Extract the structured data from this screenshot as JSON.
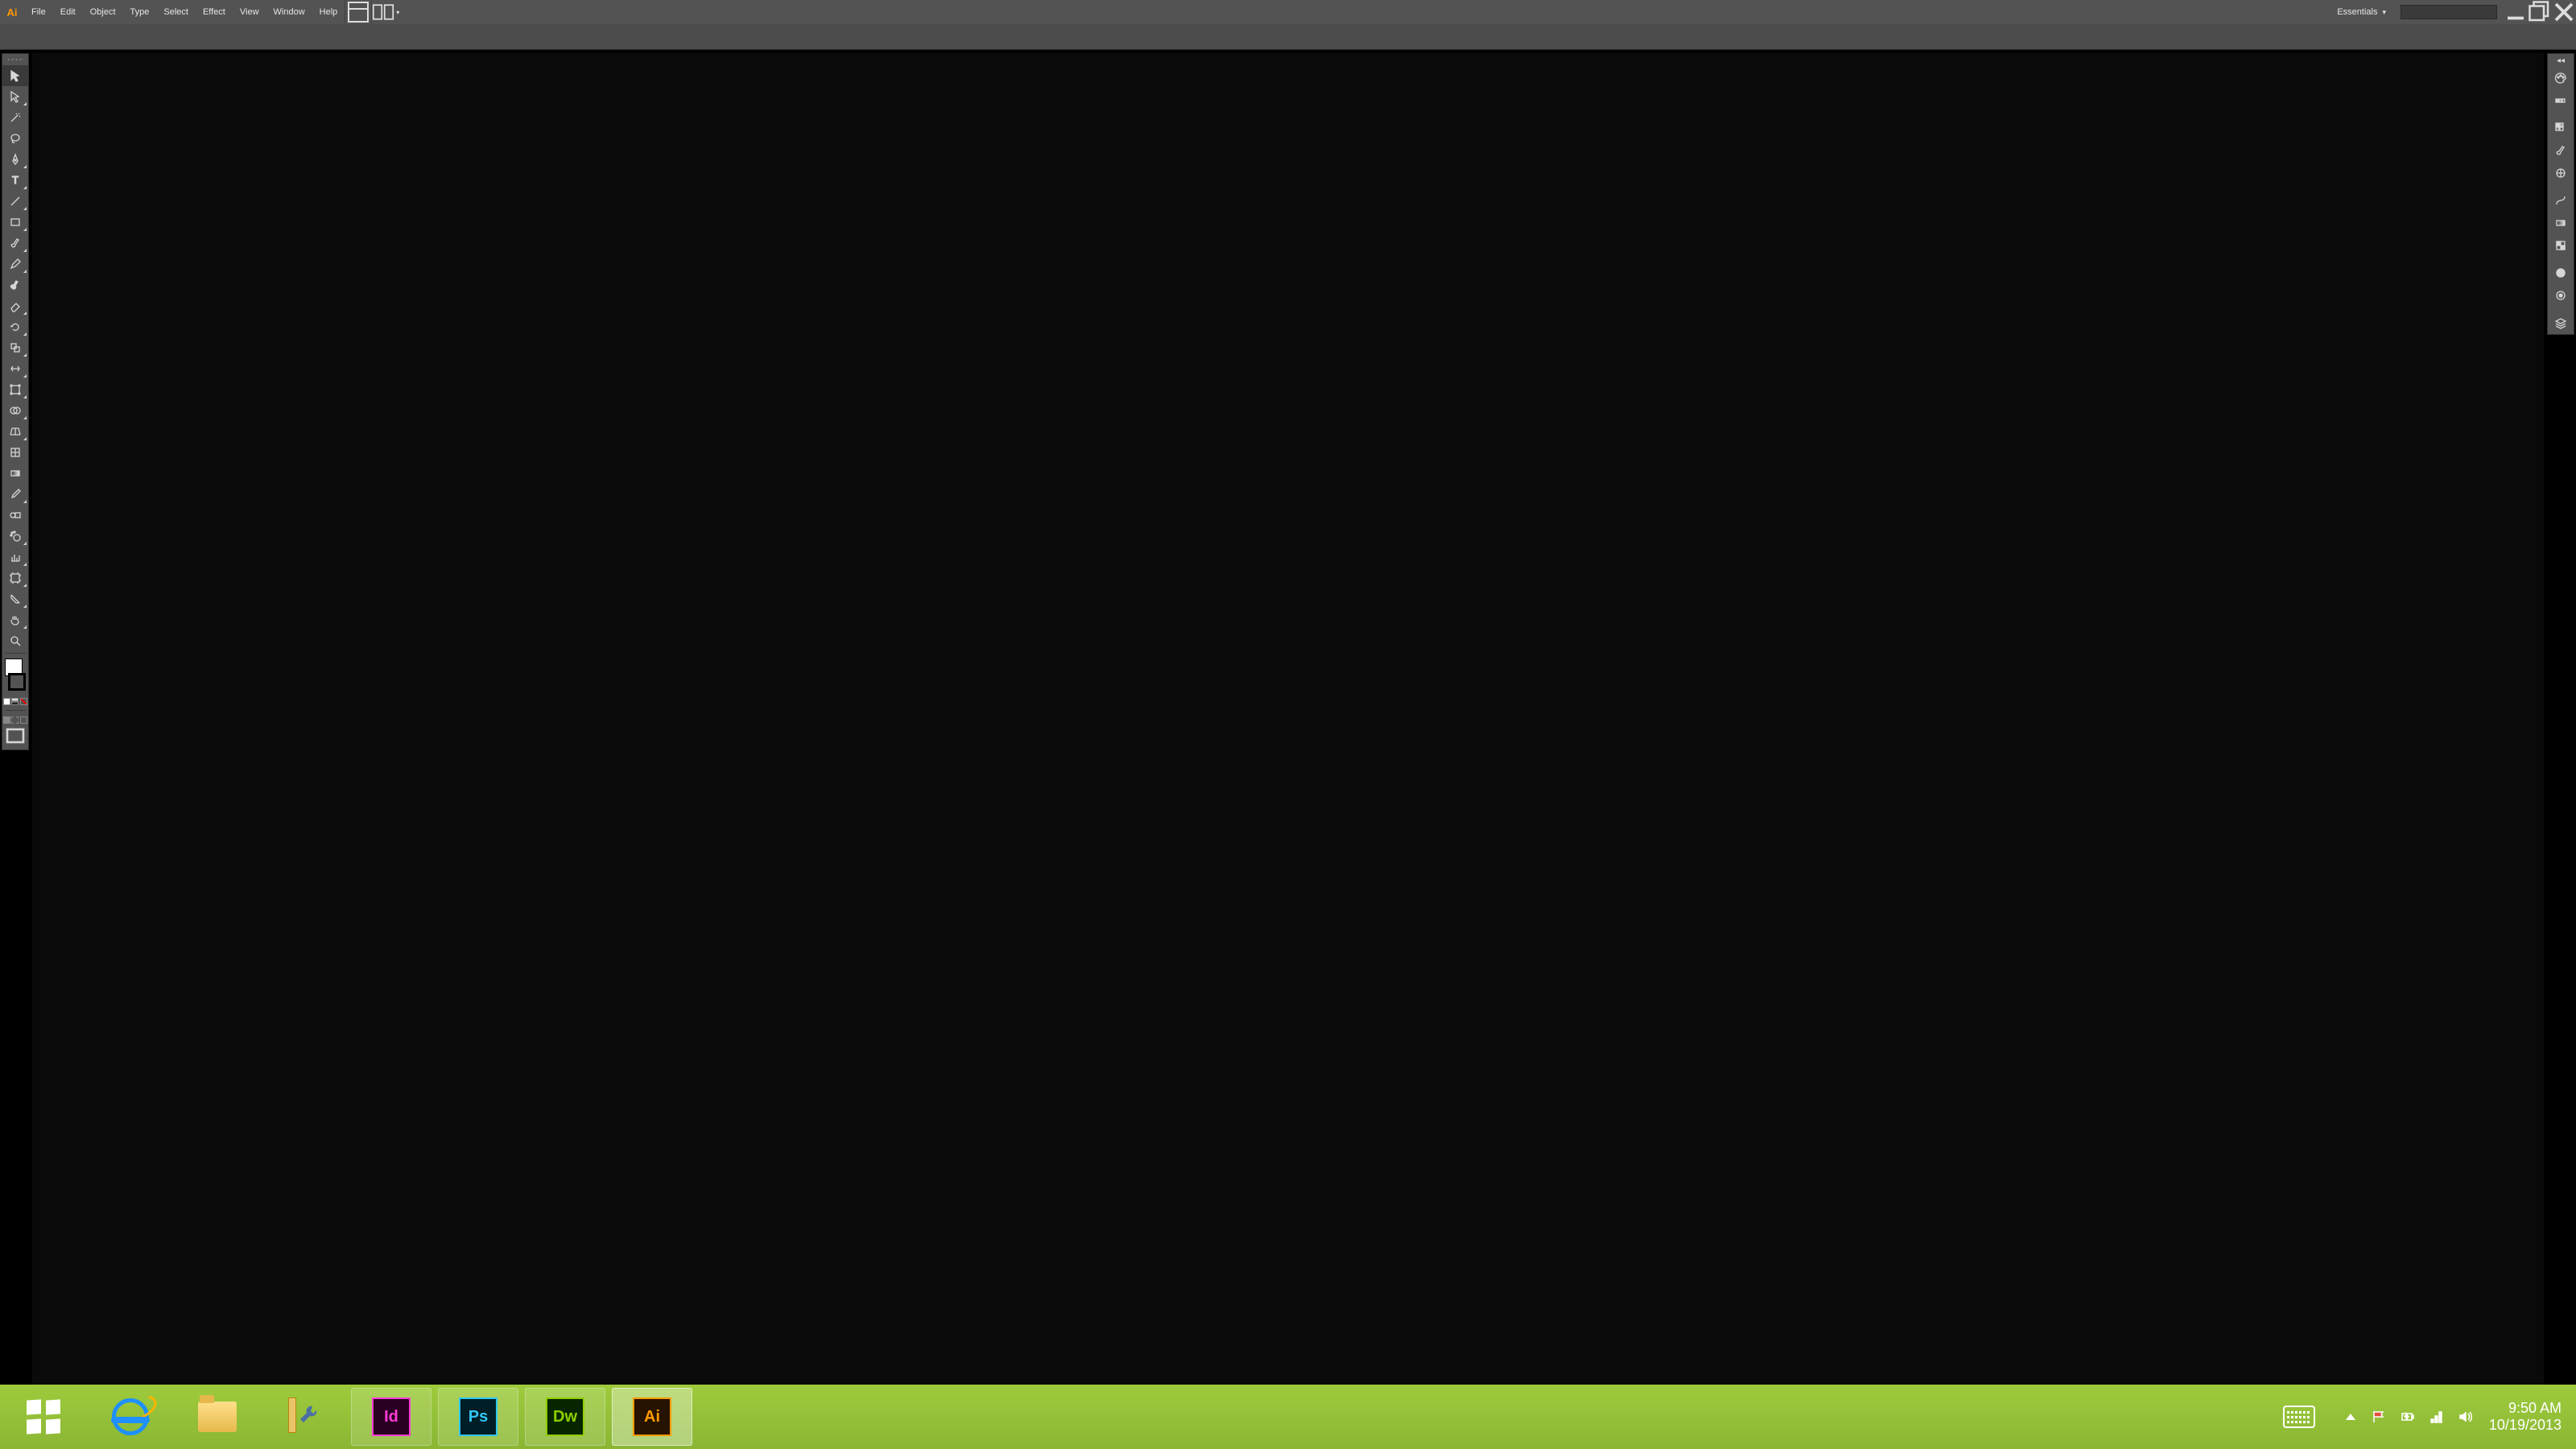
{
  "app": {
    "logo_text": "Ai"
  },
  "menu": {
    "items": [
      "File",
      "Edit",
      "Object",
      "Type",
      "Select",
      "Effect",
      "View",
      "Window",
      "Help"
    ]
  },
  "workspace": {
    "label": "Essentials"
  },
  "tools": [
    {
      "name": "selection-tool",
      "glyph": "arrow",
      "selected": true,
      "flyout": false
    },
    {
      "name": "direct-selection-tool",
      "glyph": "hollow-arrow",
      "flyout": true
    },
    {
      "name": "magic-wand-tool",
      "glyph": "wand",
      "flyout": false
    },
    {
      "name": "lasso-tool",
      "glyph": "lasso",
      "flyout": false
    },
    {
      "name": "pen-tool",
      "glyph": "pen",
      "flyout": true
    },
    {
      "name": "type-tool",
      "glyph": "T",
      "flyout": true
    },
    {
      "name": "line-segment-tool",
      "glyph": "line",
      "flyout": true
    },
    {
      "name": "rectangle-tool",
      "glyph": "rect",
      "flyout": true
    },
    {
      "name": "paintbrush-tool",
      "glyph": "brush",
      "flyout": true
    },
    {
      "name": "pencil-tool",
      "glyph": "pencil",
      "flyout": true
    },
    {
      "name": "blob-brush-tool",
      "glyph": "blob",
      "flyout": false
    },
    {
      "name": "eraser-tool",
      "glyph": "eraser",
      "flyout": true
    },
    {
      "name": "rotate-tool",
      "glyph": "rotate",
      "flyout": true
    },
    {
      "name": "scale-tool",
      "glyph": "scale",
      "flyout": true
    },
    {
      "name": "width-tool",
      "glyph": "width",
      "flyout": true
    },
    {
      "name": "free-transform-tool",
      "glyph": "transform",
      "flyout": true
    },
    {
      "name": "shape-builder-tool",
      "glyph": "shapebuilder",
      "flyout": true
    },
    {
      "name": "perspective-grid-tool",
      "glyph": "perspective",
      "flyout": true
    },
    {
      "name": "mesh-tool",
      "glyph": "mesh",
      "flyout": false
    },
    {
      "name": "gradient-tool",
      "glyph": "gradient",
      "flyout": false
    },
    {
      "name": "eyedropper-tool",
      "glyph": "eyedropper",
      "flyout": true
    },
    {
      "name": "blend-tool",
      "glyph": "blend",
      "flyout": false
    },
    {
      "name": "symbol-sprayer-tool",
      "glyph": "spray",
      "flyout": true
    },
    {
      "name": "column-graph-tool",
      "glyph": "graph",
      "flyout": true
    },
    {
      "name": "artboard-tool",
      "glyph": "artboard",
      "flyout": true
    },
    {
      "name": "slice-tool",
      "glyph": "slice",
      "flyout": true
    },
    {
      "name": "hand-tool",
      "glyph": "hand",
      "flyout": true
    },
    {
      "name": "zoom-tool",
      "glyph": "zoom",
      "flyout": false
    }
  ],
  "right_panels": [
    {
      "name": "color-panel",
      "glyph": "palette"
    },
    {
      "name": "color-guide-panel",
      "glyph": "swatchrow"
    },
    {
      "name": "swatches-panel",
      "glyph": "swatches"
    },
    {
      "name": "brushes-panel",
      "glyph": "brush"
    },
    {
      "name": "symbols-panel",
      "glyph": "symbol"
    },
    {
      "name": "stroke-panel",
      "glyph": "stroke"
    },
    {
      "name": "gradient-panel",
      "glyph": "gradient"
    },
    {
      "name": "transparency-panel",
      "glyph": "transparency"
    },
    {
      "name": "appearance-panel",
      "glyph": "appearance"
    },
    {
      "name": "graphic-styles-panel",
      "glyph": "styles"
    },
    {
      "name": "layers-panel",
      "glyph": "layers"
    }
  ],
  "taskbar": {
    "apps": [
      {
        "name": "start-button",
        "kind": "start"
      },
      {
        "name": "internet-explorer",
        "kind": "ie"
      },
      {
        "name": "file-explorer",
        "kind": "folder"
      },
      {
        "name": "windows-tools",
        "kind": "tools"
      },
      {
        "name": "adobe-indesign",
        "kind": "adobe",
        "label": "Id",
        "cls": "sq-id",
        "running": true
      },
      {
        "name": "adobe-photoshop",
        "kind": "adobe",
        "label": "Ps",
        "cls": "sq-ps",
        "running": true
      },
      {
        "name": "adobe-dreamweaver",
        "kind": "adobe",
        "label": "Dw",
        "cls": "sq-dw",
        "running": true
      },
      {
        "name": "adobe-illustrator",
        "kind": "adobe",
        "label": "Ai",
        "cls": "sq-ai",
        "running": true,
        "active": true
      }
    ],
    "clock": {
      "time": "9:50 AM",
      "date": "10/19/2013"
    }
  }
}
